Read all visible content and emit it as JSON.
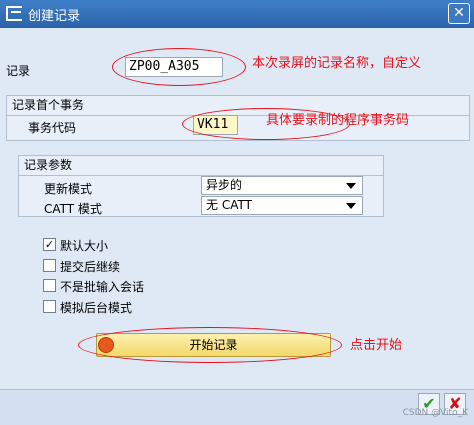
{
  "window": {
    "title": "创建记录",
    "close_label": "✕"
  },
  "record": {
    "label": "记录",
    "value": "ZP00_A305"
  },
  "group_first_tx": {
    "title": "记录首个事务",
    "tcode_label": "事务代码",
    "tcode_value": "VK11"
  },
  "group_params": {
    "title": "记录参数",
    "update_mode_label": "更新模式",
    "update_mode_value": "异步的",
    "catt_mode_label": "CATT 模式",
    "catt_mode_value": "无 CATT"
  },
  "options": [
    {
      "label": "默认大小",
      "checked": true
    },
    {
      "label": "提交后继续",
      "checked": false
    },
    {
      "label": "不是批输入会话",
      "checked": false
    },
    {
      "label": "模拟后台模式",
      "checked": false
    }
  ],
  "start_button": {
    "label": "开始记录"
  },
  "annotations": {
    "record_name": "本次录屏的记录名称，自定义",
    "tcode": "具体要录制的程序事务码",
    "start": "点击开始"
  },
  "footer": {
    "ok_label": "✔",
    "cancel_label": "✘",
    "watermark": "CSDN @Vito_K"
  },
  "colors": {
    "annotation": "#e8101a",
    "titlebar": "#2a63aa",
    "button": "#f3d86a"
  }
}
